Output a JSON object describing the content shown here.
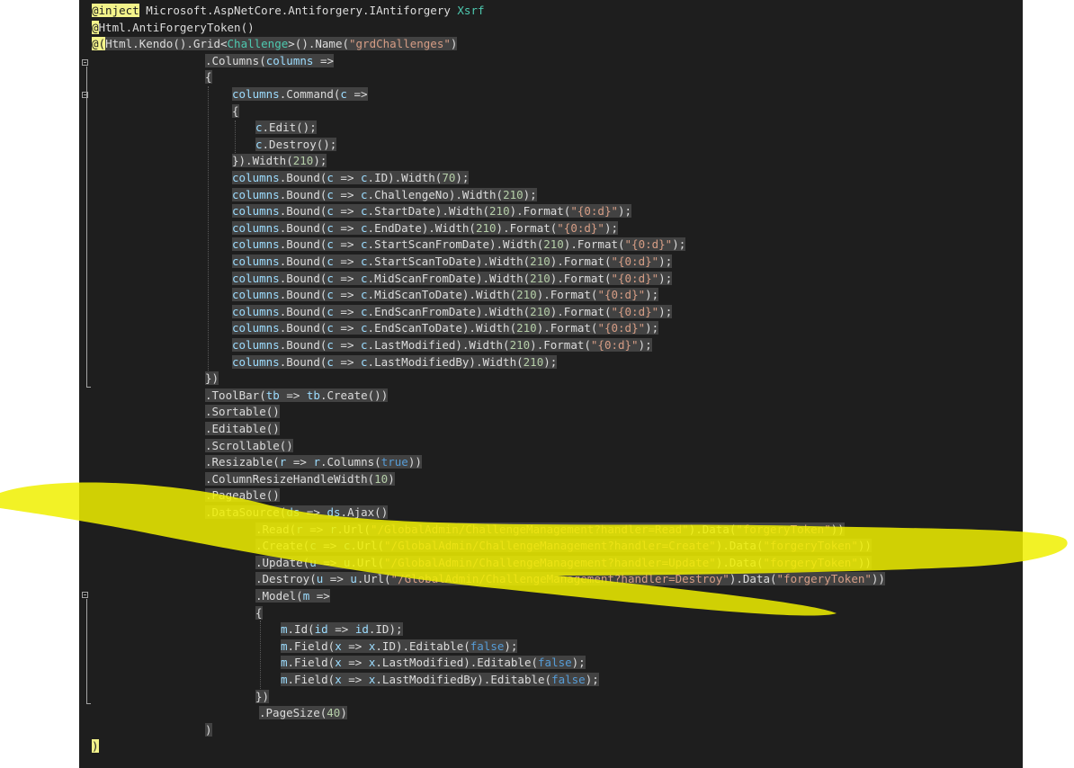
{
  "editor": {
    "theme_colors": {
      "background": "#1e1e1e",
      "selection": "#424242",
      "keyword": "#569cd6",
      "type": "#4ec9b0",
      "string": "#d69d85",
      "number": "#b5cea8",
      "variable": "#9cdcfe",
      "razor_directive": "#f3f38a",
      "annotation_marker": "#f0f000"
    },
    "lines": [
      {
        "indent": 0,
        "tokens": [
          [
            "dir",
            "@inject"
          ],
          [
            "default",
            " Microsoft.AspNetCore.Antiforgery.IAntiforgery "
          ],
          [
            "type",
            "Xsrf"
          ]
        ]
      },
      {
        "indent": 0,
        "tokens": [
          [
            "at",
            "@"
          ],
          [
            "default",
            "Html.AntiForgeryToken()"
          ]
        ]
      },
      {
        "indent": 0,
        "tokens": [
          [
            "at",
            "@("
          ],
          [
            "default",
            "Html.Kendo().Grid<"
          ],
          [
            "type",
            "Challenge"
          ],
          [
            "default",
            ">().Name("
          ],
          [
            "str",
            "\"grdChallenges\""
          ],
          [
            "default",
            ")"
          ]
        ]
      },
      {
        "indent": 1,
        "tokens": [
          [
            "default",
            ".Columns("
          ],
          [
            "var",
            "columns"
          ],
          [
            "default",
            " =>"
          ]
        ]
      },
      {
        "indent": 1,
        "tokens": [
          [
            "default",
            "{"
          ]
        ]
      },
      {
        "indent": 2,
        "tokens": [
          [
            "var",
            "columns"
          ],
          [
            "default",
            ".Command("
          ],
          [
            "var",
            "c"
          ],
          [
            "default",
            " =>"
          ]
        ]
      },
      {
        "indent": 2,
        "tokens": [
          [
            "default",
            "{"
          ]
        ]
      },
      {
        "indent": 3,
        "tokens": [
          [
            "var",
            "c"
          ],
          [
            "default",
            ".Edit();"
          ]
        ]
      },
      {
        "indent": 3,
        "tokens": [
          [
            "var",
            "c"
          ],
          [
            "default",
            ".Destroy();"
          ]
        ]
      },
      {
        "indent": 2,
        "tokens": [
          [
            "default",
            "}).Width("
          ],
          [
            "num",
            "210"
          ],
          [
            "default",
            ");"
          ]
        ]
      },
      {
        "indent": 2,
        "tokens": [
          [
            "var",
            "columns"
          ],
          [
            "default",
            ".Bound("
          ],
          [
            "var",
            "c"
          ],
          [
            "default",
            " => "
          ],
          [
            "var",
            "c"
          ],
          [
            "default",
            ".ID).Width("
          ],
          [
            "num",
            "70"
          ],
          [
            "default",
            ");"
          ]
        ]
      },
      {
        "indent": 2,
        "tokens": [
          [
            "var",
            "columns"
          ],
          [
            "default",
            ".Bound("
          ],
          [
            "var",
            "c"
          ],
          [
            "default",
            " => "
          ],
          [
            "var",
            "c"
          ],
          [
            "default",
            ".ChallengeNo).Width("
          ],
          [
            "num",
            "210"
          ],
          [
            "default",
            ");"
          ]
        ]
      },
      {
        "indent": 2,
        "tokens": [
          [
            "var",
            "columns"
          ],
          [
            "default",
            ".Bound("
          ],
          [
            "var",
            "c"
          ],
          [
            "default",
            " => "
          ],
          [
            "var",
            "c"
          ],
          [
            "default",
            ".StartDate).Width("
          ],
          [
            "num",
            "210"
          ],
          [
            "default",
            ").Format("
          ],
          [
            "str",
            "\"{0:d}\""
          ],
          [
            "default",
            ");"
          ]
        ]
      },
      {
        "indent": 2,
        "tokens": [
          [
            "var",
            "columns"
          ],
          [
            "default",
            ".Bound("
          ],
          [
            "var",
            "c"
          ],
          [
            "default",
            " => "
          ],
          [
            "var",
            "c"
          ],
          [
            "default",
            ".EndDate).Width("
          ],
          [
            "num",
            "210"
          ],
          [
            "default",
            ").Format("
          ],
          [
            "str",
            "\"{0:d}\""
          ],
          [
            "default",
            ");"
          ]
        ]
      },
      {
        "indent": 2,
        "tokens": [
          [
            "var",
            "columns"
          ],
          [
            "default",
            ".Bound("
          ],
          [
            "var",
            "c"
          ],
          [
            "default",
            " => "
          ],
          [
            "var",
            "c"
          ],
          [
            "default",
            ".StartScanFromDate).Width("
          ],
          [
            "num",
            "210"
          ],
          [
            "default",
            ").Format("
          ],
          [
            "str",
            "\"{0:d}\""
          ],
          [
            "default",
            ");"
          ]
        ]
      },
      {
        "indent": 2,
        "tokens": [
          [
            "var",
            "columns"
          ],
          [
            "default",
            ".Bound("
          ],
          [
            "var",
            "c"
          ],
          [
            "default",
            " => "
          ],
          [
            "var",
            "c"
          ],
          [
            "default",
            ".StartScanToDate).Width("
          ],
          [
            "num",
            "210"
          ],
          [
            "default",
            ").Format("
          ],
          [
            "str",
            "\"{0:d}\""
          ],
          [
            "default",
            ");"
          ]
        ]
      },
      {
        "indent": 2,
        "tokens": [
          [
            "var",
            "columns"
          ],
          [
            "default",
            ".Bound("
          ],
          [
            "var",
            "c"
          ],
          [
            "default",
            " => "
          ],
          [
            "var",
            "c"
          ],
          [
            "default",
            ".MidScanFromDate).Width("
          ],
          [
            "num",
            "210"
          ],
          [
            "default",
            ").Format("
          ],
          [
            "str",
            "\"{0:d}\""
          ],
          [
            "default",
            ");"
          ]
        ]
      },
      {
        "indent": 2,
        "tokens": [
          [
            "var",
            "columns"
          ],
          [
            "default",
            ".Bound("
          ],
          [
            "var",
            "c"
          ],
          [
            "default",
            " => "
          ],
          [
            "var",
            "c"
          ],
          [
            "default",
            ".MidScanToDate).Width("
          ],
          [
            "num",
            "210"
          ],
          [
            "default",
            ").Format("
          ],
          [
            "str",
            "\"{0:d}\""
          ],
          [
            "default",
            ");"
          ]
        ]
      },
      {
        "indent": 2,
        "tokens": [
          [
            "var",
            "columns"
          ],
          [
            "default",
            ".Bound("
          ],
          [
            "var",
            "c"
          ],
          [
            "default",
            " => "
          ],
          [
            "var",
            "c"
          ],
          [
            "default",
            ".EndScanFromDate).Width("
          ],
          [
            "num",
            "210"
          ],
          [
            "default",
            ").Format("
          ],
          [
            "str",
            "\"{0:d}\""
          ],
          [
            "default",
            ");"
          ]
        ]
      },
      {
        "indent": 2,
        "tokens": [
          [
            "var",
            "columns"
          ],
          [
            "default",
            ".Bound("
          ],
          [
            "var",
            "c"
          ],
          [
            "default",
            " => "
          ],
          [
            "var",
            "c"
          ],
          [
            "default",
            ".EndScanToDate).Width("
          ],
          [
            "num",
            "210"
          ],
          [
            "default",
            ").Format("
          ],
          [
            "str",
            "\"{0:d}\""
          ],
          [
            "default",
            ");"
          ]
        ]
      },
      {
        "indent": 2,
        "tokens": [
          [
            "var",
            "columns"
          ],
          [
            "default",
            ".Bound("
          ],
          [
            "var",
            "c"
          ],
          [
            "default",
            " => "
          ],
          [
            "var",
            "c"
          ],
          [
            "default",
            ".LastModified).Width("
          ],
          [
            "num",
            "210"
          ],
          [
            "default",
            ").Format("
          ],
          [
            "str",
            "\"{0:d}\""
          ],
          [
            "default",
            ");"
          ]
        ]
      },
      {
        "indent": 2,
        "tokens": [
          [
            "var",
            "columns"
          ],
          [
            "default",
            ".Bound("
          ],
          [
            "var",
            "c"
          ],
          [
            "default",
            " => "
          ],
          [
            "var",
            "c"
          ],
          [
            "default",
            ".LastModifiedBy).Width("
          ],
          [
            "num",
            "210"
          ],
          [
            "default",
            ");"
          ]
        ]
      },
      {
        "indent": 1,
        "tokens": [
          [
            "default",
            "})"
          ]
        ]
      },
      {
        "indent": 1,
        "tokens": [
          [
            "default",
            ".ToolBar("
          ],
          [
            "var",
            "tb"
          ],
          [
            "default",
            " => "
          ],
          [
            "var",
            "tb"
          ],
          [
            "default",
            ".Create())"
          ]
        ]
      },
      {
        "indent": 1,
        "tokens": [
          [
            "default",
            ".Sortable()"
          ]
        ]
      },
      {
        "indent": 1,
        "tokens": [
          [
            "default",
            ".Editable()"
          ]
        ]
      },
      {
        "indent": 1,
        "tokens": [
          [
            "default",
            ".Scrollable()"
          ]
        ]
      },
      {
        "indent": 1,
        "tokens": [
          [
            "default",
            ".Resizable("
          ],
          [
            "var",
            "r"
          ],
          [
            "default",
            " => "
          ],
          [
            "var",
            "r"
          ],
          [
            "default",
            ".Columns("
          ],
          [
            "kw",
            "true"
          ],
          [
            "default",
            "))"
          ]
        ]
      },
      {
        "indent": 1,
        "tokens": [
          [
            "default",
            ".ColumnResizeHandleWidth("
          ],
          [
            "num",
            "10"
          ],
          [
            "default",
            ")"
          ]
        ]
      },
      {
        "indent": 1,
        "tokens": [
          [
            "default",
            ".Pageable()"
          ]
        ]
      },
      {
        "indent": 1,
        "tokens": [
          [
            "default",
            ".DataSource("
          ],
          [
            "var",
            "ds"
          ],
          [
            "default",
            " => "
          ],
          [
            "var",
            "ds"
          ],
          [
            "default",
            ".Ajax()"
          ]
        ]
      },
      {
        "indent": 3,
        "tokens": [
          [
            "default",
            ".Read("
          ],
          [
            "var",
            "r"
          ],
          [
            "default",
            " => "
          ],
          [
            "var",
            "r"
          ],
          [
            "default",
            ".Url("
          ],
          [
            "str",
            "\"/GlobalAdmin/ChallengeManagement?handler=Read\""
          ],
          [
            "default",
            ").Data("
          ],
          [
            "str",
            "\"forgeryToken\""
          ],
          [
            "default",
            "))"
          ]
        ]
      },
      {
        "indent": 3,
        "tokens": [
          [
            "default",
            ".Create("
          ],
          [
            "var",
            "c"
          ],
          [
            "default",
            " => "
          ],
          [
            "var",
            "c"
          ],
          [
            "default",
            ".Url("
          ],
          [
            "str",
            "\"/GlobalAdmin/ChallengeManagement?handler=Create\""
          ],
          [
            "default",
            ").Data("
          ],
          [
            "str",
            "\"forgeryToken\""
          ],
          [
            "default",
            "))"
          ]
        ]
      },
      {
        "indent": 3,
        "tokens": [
          [
            "default",
            ".Update("
          ],
          [
            "var",
            "u"
          ],
          [
            "default",
            " => "
          ],
          [
            "var",
            "u"
          ],
          [
            "default",
            ".Url("
          ],
          [
            "str",
            "\"/GlobalAdmin/ChallengeManagement?handler=Update\""
          ],
          [
            "default",
            ").Data("
          ],
          [
            "str",
            "\"forgeryToken\""
          ],
          [
            "default",
            "))"
          ]
        ]
      },
      {
        "indent": 3,
        "tokens": [
          [
            "default",
            ".Destroy("
          ],
          [
            "var",
            "u"
          ],
          [
            "default",
            " => "
          ],
          [
            "var",
            "u"
          ],
          [
            "default",
            ".Url("
          ],
          [
            "str",
            "\"/GlobalAdmin/ChallengeManagement?handler=Destroy\""
          ],
          [
            "default",
            ").Data("
          ],
          [
            "str",
            "\"forgeryToken\""
          ],
          [
            "default",
            "))"
          ]
        ]
      },
      {
        "indent": 3,
        "tokens": [
          [
            "default",
            ".Model("
          ],
          [
            "var",
            "m"
          ],
          [
            "default",
            " =>"
          ]
        ]
      },
      {
        "indent": 3,
        "tokens": [
          [
            "default",
            "{"
          ]
        ]
      },
      {
        "indent": 4,
        "tokens": [
          [
            "var",
            "m"
          ],
          [
            "default",
            ".Id("
          ],
          [
            "var",
            "id"
          ],
          [
            "default",
            " => "
          ],
          [
            "var",
            "id"
          ],
          [
            "default",
            ".ID);"
          ]
        ]
      },
      {
        "indent": 4,
        "tokens": [
          [
            "var",
            "m"
          ],
          [
            "default",
            ".Field("
          ],
          [
            "var",
            "x"
          ],
          [
            "default",
            " => "
          ],
          [
            "var",
            "x"
          ],
          [
            "default",
            ".ID).Editable("
          ],
          [
            "kw",
            "false"
          ],
          [
            "default",
            ");"
          ]
        ]
      },
      {
        "indent": 4,
        "tokens": [
          [
            "var",
            "m"
          ],
          [
            "default",
            ".Field("
          ],
          [
            "var",
            "x"
          ],
          [
            "default",
            " => "
          ],
          [
            "var",
            "x"
          ],
          [
            "default",
            ".LastModified).Editable("
          ],
          [
            "kw",
            "false"
          ],
          [
            "default",
            ");"
          ]
        ]
      },
      {
        "indent": 4,
        "tokens": [
          [
            "var",
            "m"
          ],
          [
            "default",
            ".Field("
          ],
          [
            "var",
            "x"
          ],
          [
            "default",
            " => "
          ],
          [
            "var",
            "x"
          ],
          [
            "default",
            ".LastModifiedBy).Editable("
          ],
          [
            "kw",
            "false"
          ],
          [
            "default",
            ");"
          ]
        ]
      },
      {
        "indent": 3,
        "tokens": [
          [
            "default",
            "})"
          ]
        ]
      },
      {
        "indent": 5,
        "tokens": [
          [
            "default",
            ".PageSize("
          ],
          [
            "num",
            "40"
          ],
          [
            "default",
            ")"
          ]
        ]
      },
      {
        "indent": 1,
        "tokens": [
          [
            "default",
            ")"
          ]
        ]
      },
      {
        "indent": 6,
        "tokens": [
          [
            "at",
            ")"
          ]
        ]
      }
    ]
  }
}
